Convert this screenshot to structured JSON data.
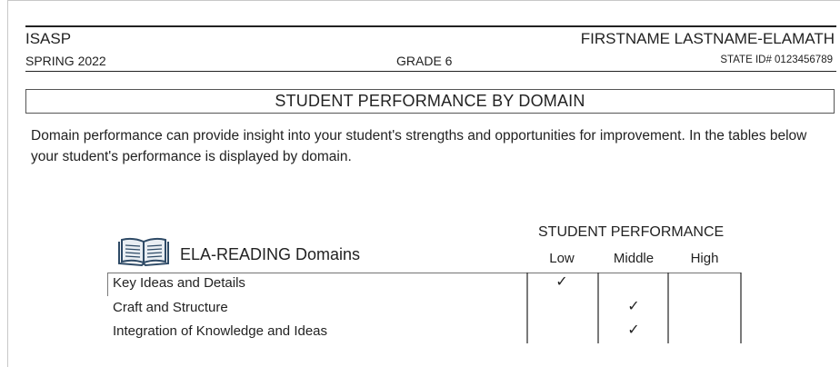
{
  "header": {
    "program": "ISASP",
    "term": "SPRING 2022",
    "grade": "GRADE 6",
    "student_name": "FIRSTNAME LASTNAME-ELAMATH",
    "state_id": "STATE ID# 0123456789"
  },
  "section_title": "STUDENT PERFORMANCE BY DOMAIN",
  "intro": "Domain performance can provide insight into your student's strengths and opportunities for improvement. In the tables below your student's performance is displayed by domain.",
  "table": {
    "performance_heading": "STUDENT PERFORMANCE",
    "domain_heading": "ELA-READING Domains",
    "icon": "open-book-icon",
    "levels": [
      "Low",
      "Middle",
      "High"
    ],
    "check_mark": "✓",
    "rows": [
      {
        "domain": "Key Ideas and Details",
        "level": "Low"
      },
      {
        "domain": "Craft and Structure",
        "level": "Middle"
      },
      {
        "domain": "Integration of Knowledge and Ideas",
        "level": "Middle"
      }
    ]
  },
  "colors": {
    "text": "#222222",
    "rule": "#222222",
    "frame": "#c8c8c8"
  }
}
